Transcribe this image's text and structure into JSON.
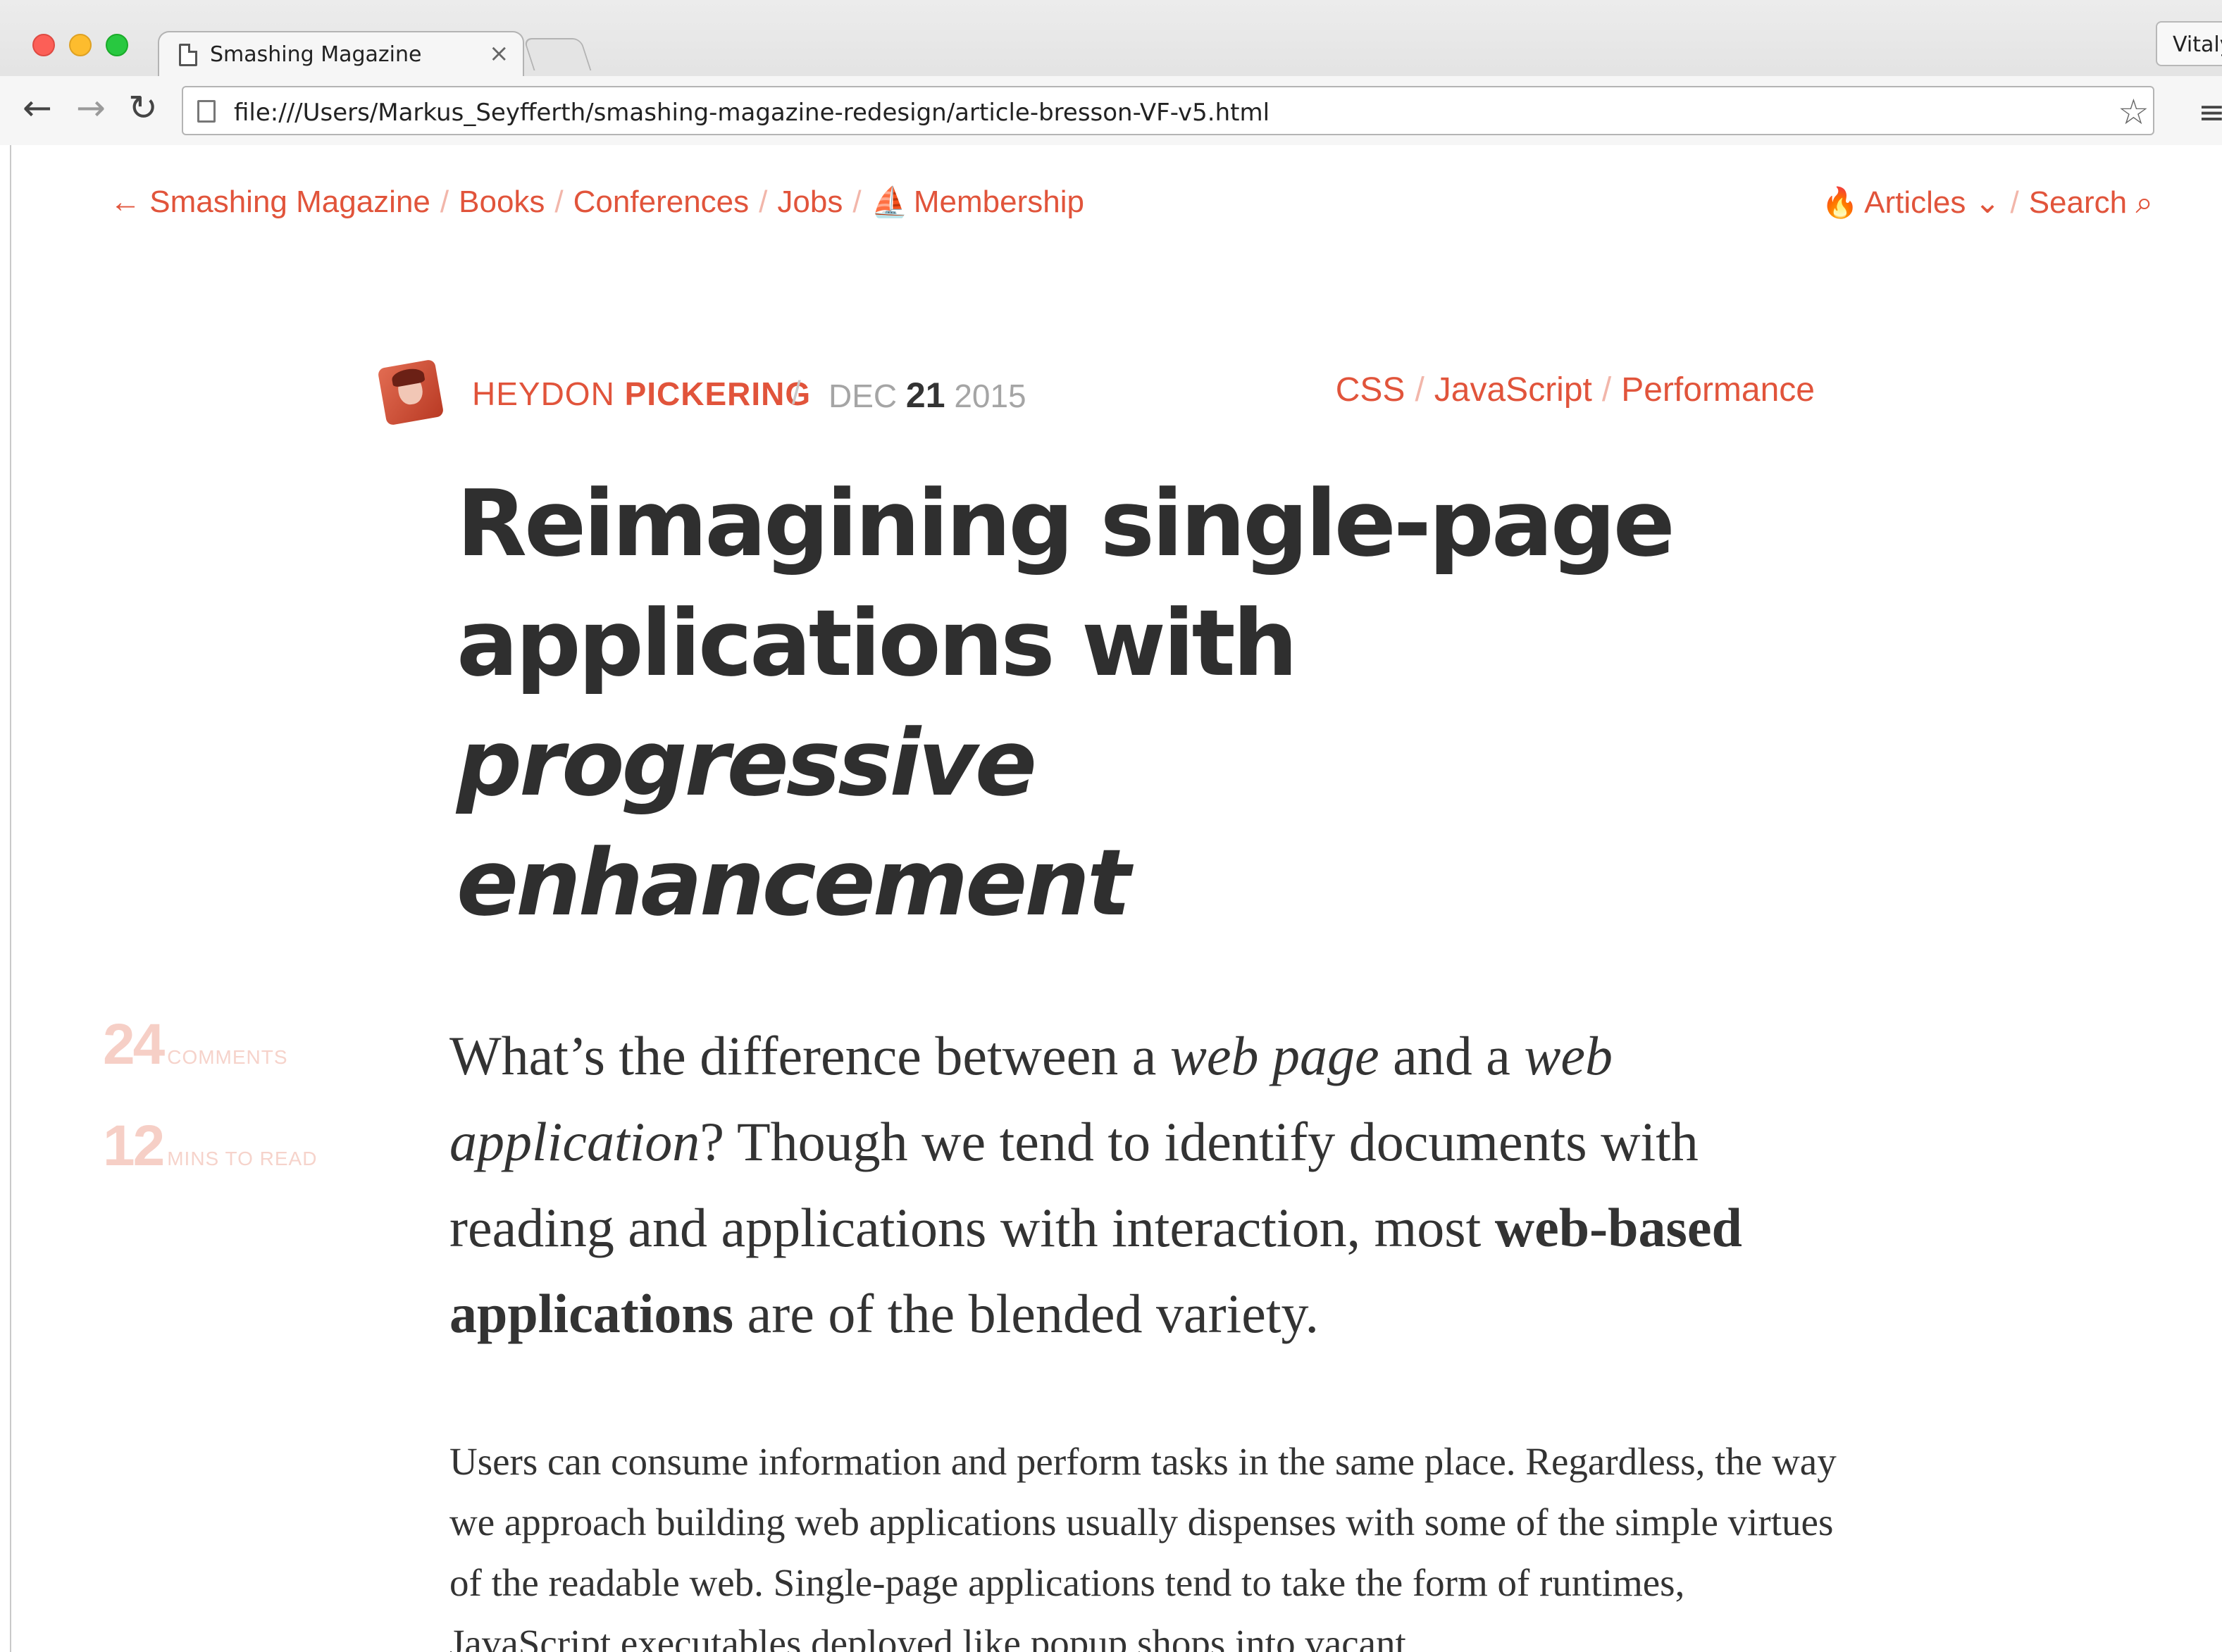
{
  "browser": {
    "tab_title": "Smashing Magazine",
    "tab_close": "×",
    "profile_name": "Vitaly",
    "url": "file:///Users/Markus_Seyfferth/smashing-magazine-redesign/article-bresson-VF-v5.html",
    "back_glyph": "←",
    "forward_glyph": "→",
    "reload_glyph": "↻",
    "star_glyph": "☆",
    "menu_glyph": "≡"
  },
  "site_nav": {
    "home": "← Smashing Magazine",
    "books": "Books",
    "conferences": "Conferences",
    "jobs": "Jobs",
    "membership_icon": "⛵",
    "membership": "Membership",
    "articles_icon": "🔥",
    "articles": "Articles",
    "articles_chevron": "⌄",
    "search": "Search",
    "search_icon": "⌕",
    "separator": "/"
  },
  "article": {
    "author_first": "HEYDON",
    "author_last": "PICKERING",
    "meta_separator": "/",
    "date_month": "DEC",
    "date_day": "21",
    "date_year": "2015",
    "tags": [
      "CSS",
      "JavaScript",
      "Performance"
    ],
    "title_line1": "Reimagining single-page",
    "title_line2_plain": "applications with ",
    "title_line2_italic": "progressive",
    "title_line3_italic": "enhancement",
    "stats": {
      "comments_count": "24",
      "comments_label": "COMMENTS",
      "read_count": "12",
      "read_label": "MINS TO READ"
    },
    "lead": {
      "p1": "What’s the difference between a ",
      "em1": "web page",
      "p2": " and a ",
      "em2": "web application",
      "p3": "? Though we tend to identify documents with reading and applications with interaction, most ",
      "strong": "web-based applications",
      "p4": " are of the blended variety."
    },
    "body_paragraph": "Users can consume information and perform tasks in the same place. Regardless, the way we approach building web applications usually dispenses with some of the simple virtues of the readable web. Single-page applications tend to take the form of runtimes, JavaScript executables deployed like popup shops into vacant"
  },
  "colors": {
    "accent": "#e1543b",
    "accent_light": "#f2b6aa",
    "stat_color": "#f6cfc6",
    "heading": "#2f2f2f",
    "text": "#333333"
  }
}
